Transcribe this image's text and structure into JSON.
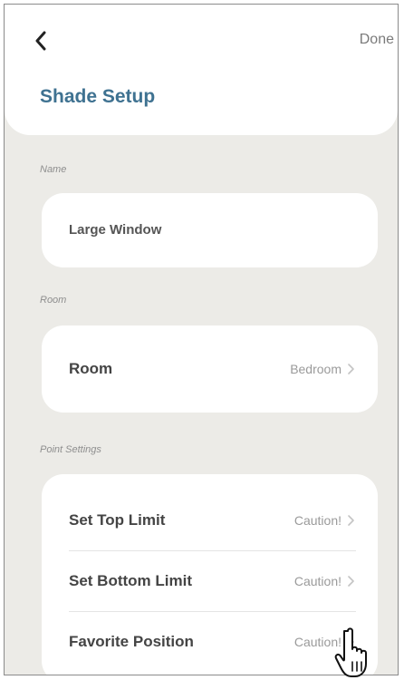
{
  "nav": {
    "done_label": "Done"
  },
  "header": {
    "title": "Shade Setup"
  },
  "name_section": {
    "label": "Name",
    "value": "Large Window"
  },
  "room_section": {
    "label": "Room",
    "row_label": "Room",
    "row_value": "Bedroom"
  },
  "point_section": {
    "label": "Point Settings",
    "items": [
      {
        "label": "Set Top Limit",
        "value": "Caution!"
      },
      {
        "label": "Set Bottom Limit",
        "value": "Caution!"
      },
      {
        "label": "Favorite Position",
        "value": "Caution!"
      }
    ]
  },
  "colors": {
    "accent": "#3f7291",
    "background": "#ecebe7",
    "card": "#ffffff"
  }
}
